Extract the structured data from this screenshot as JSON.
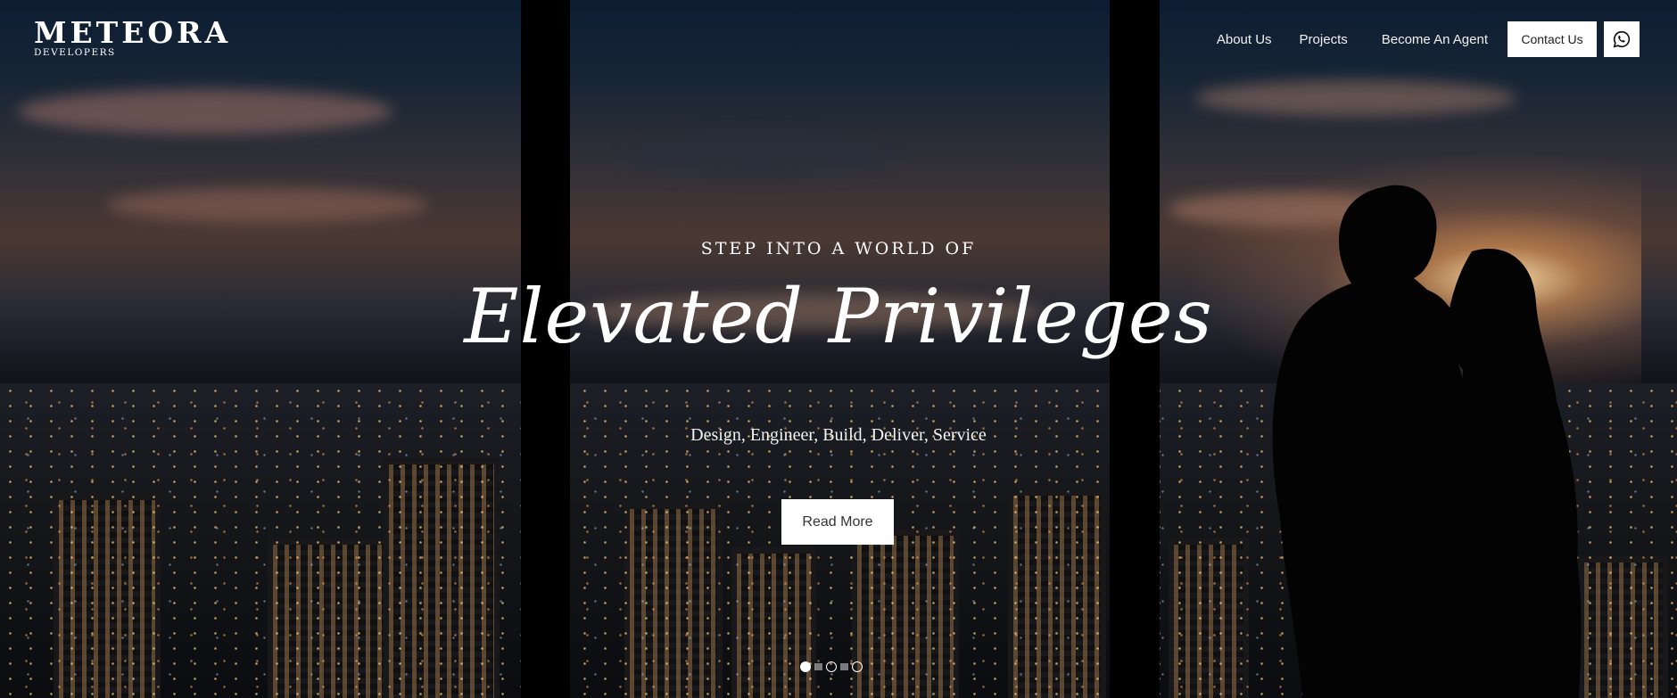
{
  "logo": {
    "name": "METEORA",
    "subtitle": "DEVELOPERS"
  },
  "nav": {
    "links": [
      "About Us",
      "Projects",
      "Become An Agent"
    ],
    "contact_label": "Contact Us",
    "whatsapp_icon": "whatsapp-icon"
  },
  "hero": {
    "overline": "STEP INTO A WORLD OF",
    "script_title": "Elevated Privileges",
    "tagline": "Design, Engineer, Build, Deliver, Service",
    "cta_label": "Read More",
    "slides": {
      "count": 3,
      "active": 1
    }
  },
  "colors": {
    "accent": "#ffffff",
    "background": "#0b0c0f"
  }
}
